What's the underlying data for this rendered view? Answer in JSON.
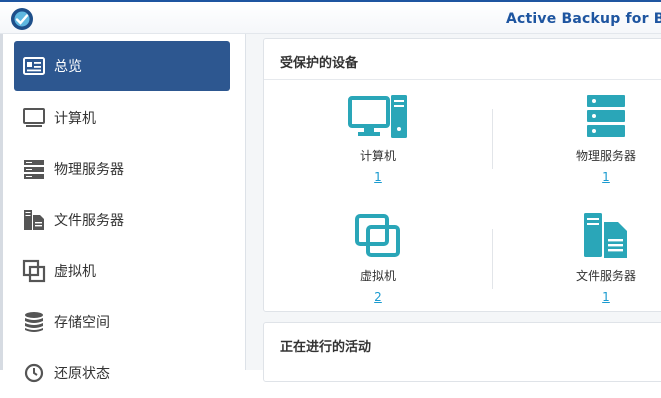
{
  "app": {
    "title": "Active Backup for Bus"
  },
  "sidebar": {
    "items": [
      {
        "label": "总览",
        "icon": "overview-icon",
        "active": true
      },
      {
        "label": "计算机",
        "icon": "computer-icon"
      },
      {
        "label": "物理服务器",
        "icon": "server-icon"
      },
      {
        "label": "文件服务器",
        "icon": "file-server-icon"
      },
      {
        "label": "虚拟机",
        "icon": "virtual-machine-icon"
      },
      {
        "label": "存储空间",
        "icon": "storage-icon"
      },
      {
        "label": "还原状态",
        "icon": "restore-icon"
      }
    ]
  },
  "protected": {
    "title": "受保护的设备",
    "devices": [
      {
        "label": "计算机",
        "count": "1",
        "icon": "computer-icon"
      },
      {
        "label": "物理服务器",
        "count": "1",
        "icon": "server-icon"
      },
      {
        "label": "虚拟机",
        "count": "2",
        "icon": "virtual-machine-icon"
      },
      {
        "label": "文件服务器",
        "count": "1",
        "icon": "file-server-icon"
      }
    ]
  },
  "activity": {
    "title": "正在进行的活动"
  },
  "colors": {
    "accent": "#2d5790",
    "icon_teal": "#2aa6b8",
    "link": "#1a9bd0",
    "brand": "#1e55a0"
  }
}
